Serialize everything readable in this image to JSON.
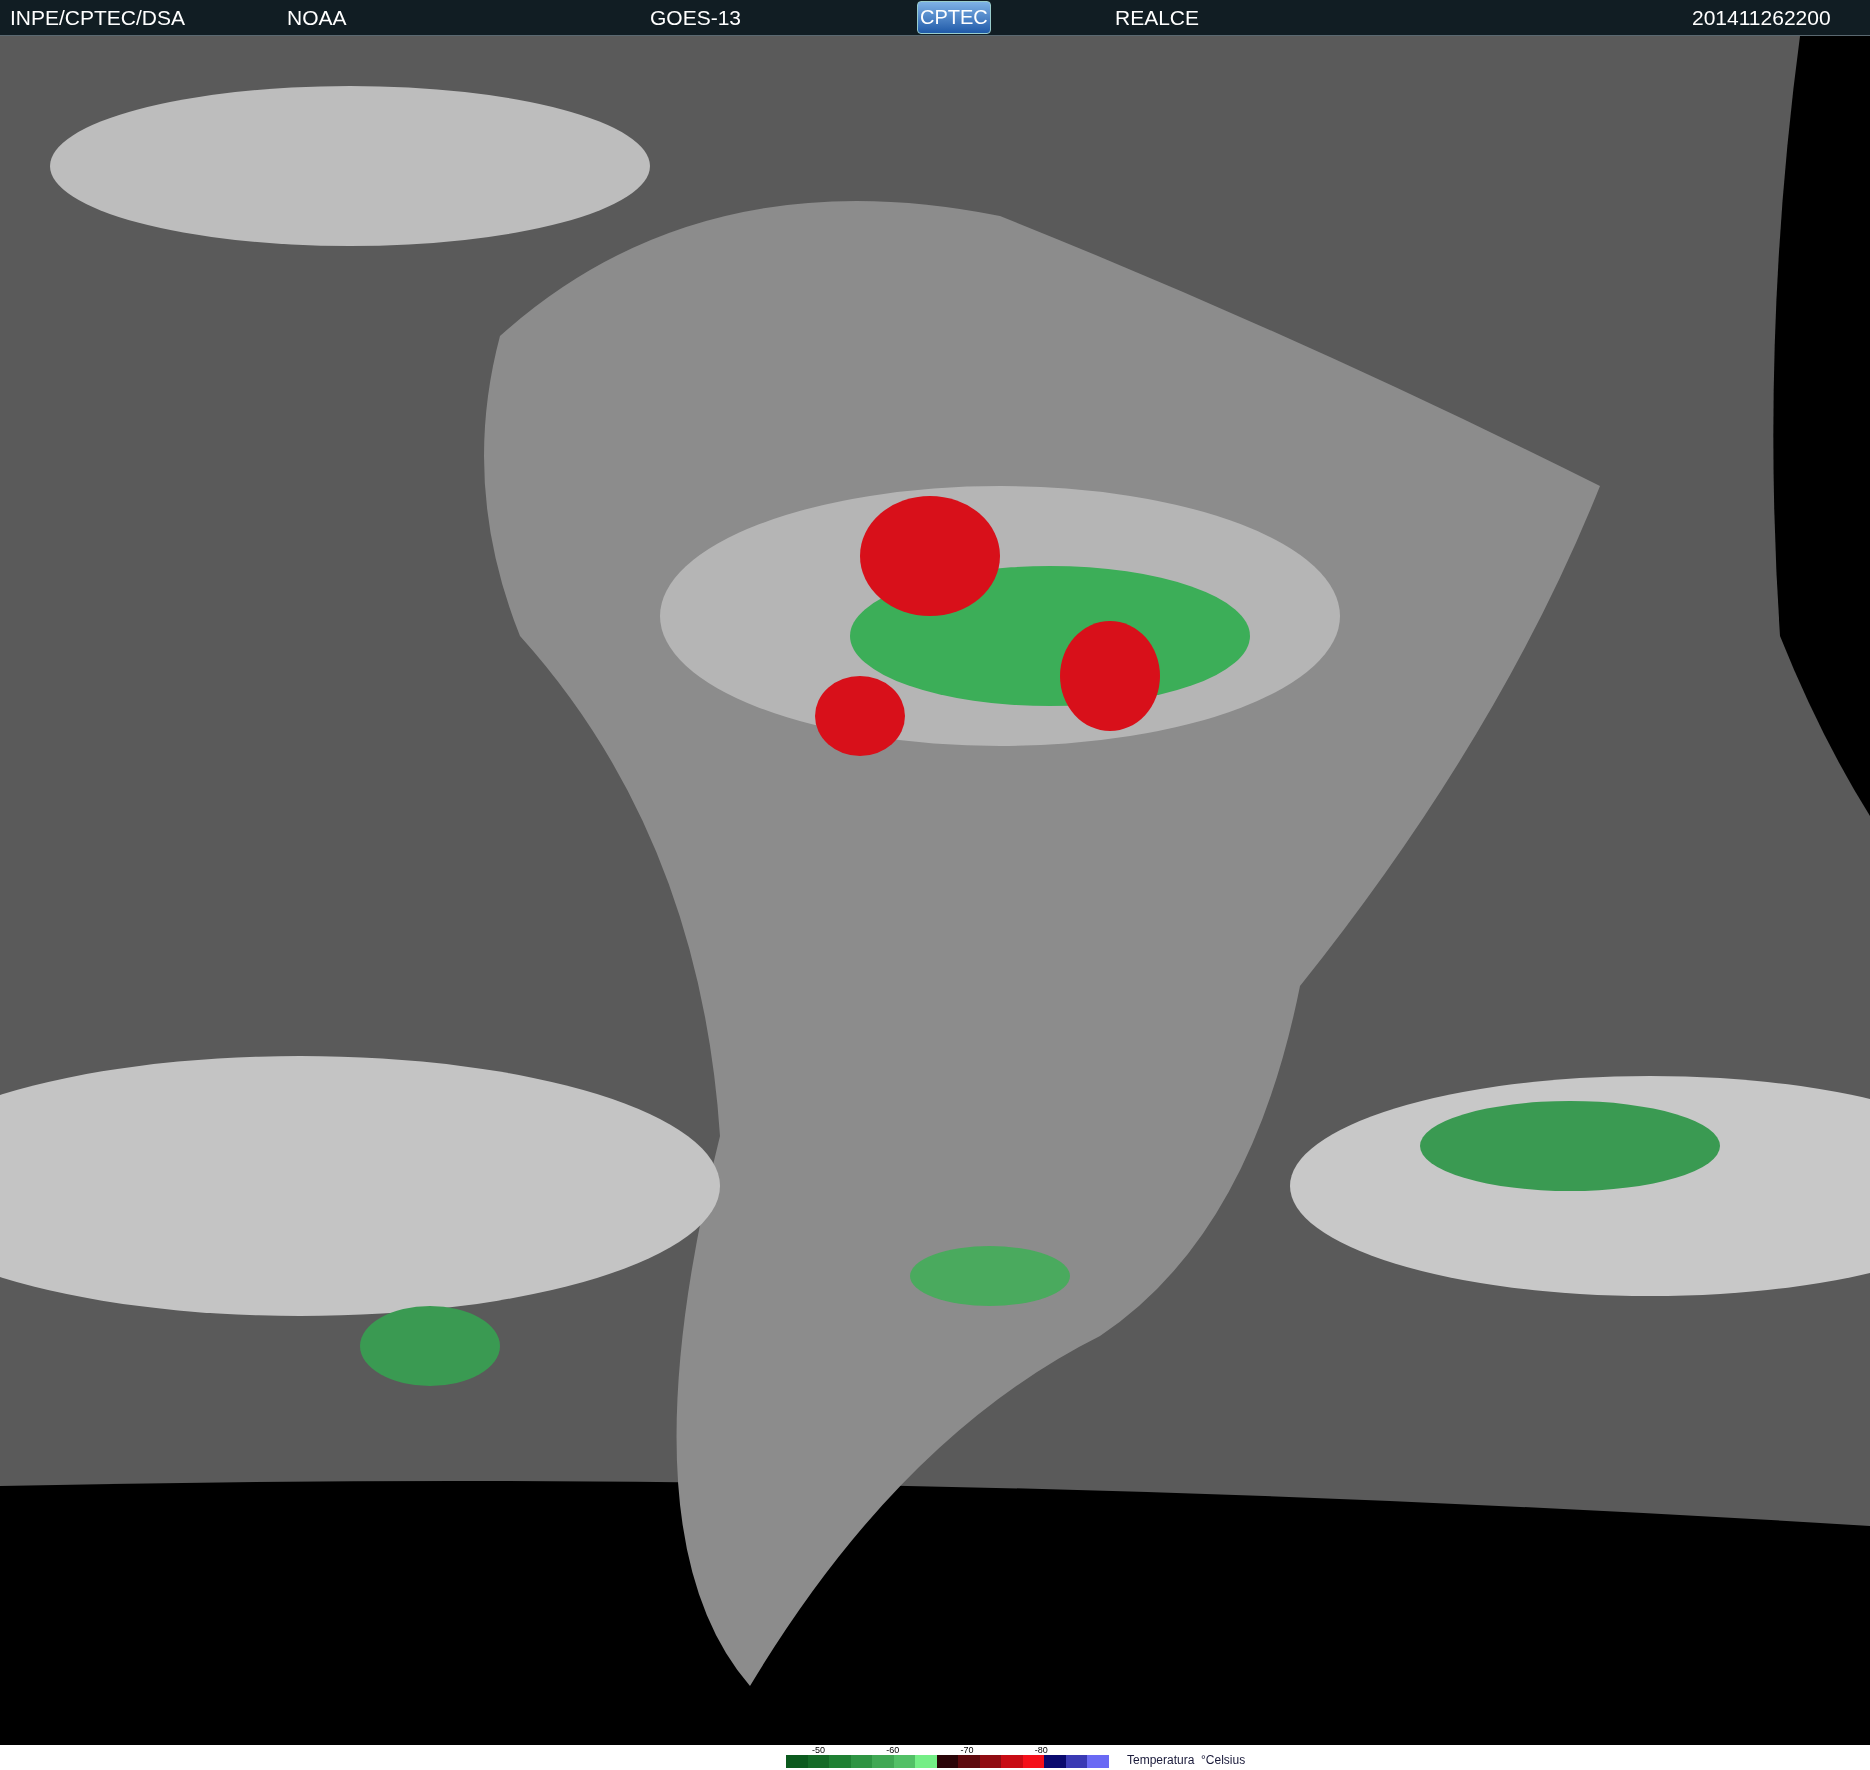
{
  "header": {
    "items": [
      {
        "kind": "text",
        "text": "INPE/CPTEC/DSA"
      },
      {
        "kind": "text",
        "text": "NOAA"
      },
      {
        "kind": "text",
        "text": "GOES-13"
      },
      {
        "kind": "logo",
        "text": "CPTEC"
      },
      {
        "kind": "text",
        "text": "REALCE"
      },
      {
        "kind": "text",
        "text": "201411262200"
      }
    ]
  },
  "legend": {
    "ticks": [
      "-50",
      "-60",
      "-70",
      "-80"
    ],
    "swatches": [
      {
        "color": "#0b5a1e"
      },
      {
        "color": "#146b27"
      },
      {
        "color": "#1f8033"
      },
      {
        "color": "#2e9443"
      },
      {
        "color": "#40a854"
      },
      {
        "color": "#52c066"
      },
      {
        "color": "#74ee86"
      },
      {
        "color": "#2a0508"
      },
      {
        "color": "#5e0a0e"
      },
      {
        "color": "#900c12"
      },
      {
        "color": "#c80c14"
      },
      {
        "color": "#f5101a"
      },
      {
        "color": "#0a0a6e"
      },
      {
        "color": "#3a3ab4"
      },
      {
        "color": "#6a6af4"
      }
    ],
    "label": "Temperatura  °Celsius"
  }
}
